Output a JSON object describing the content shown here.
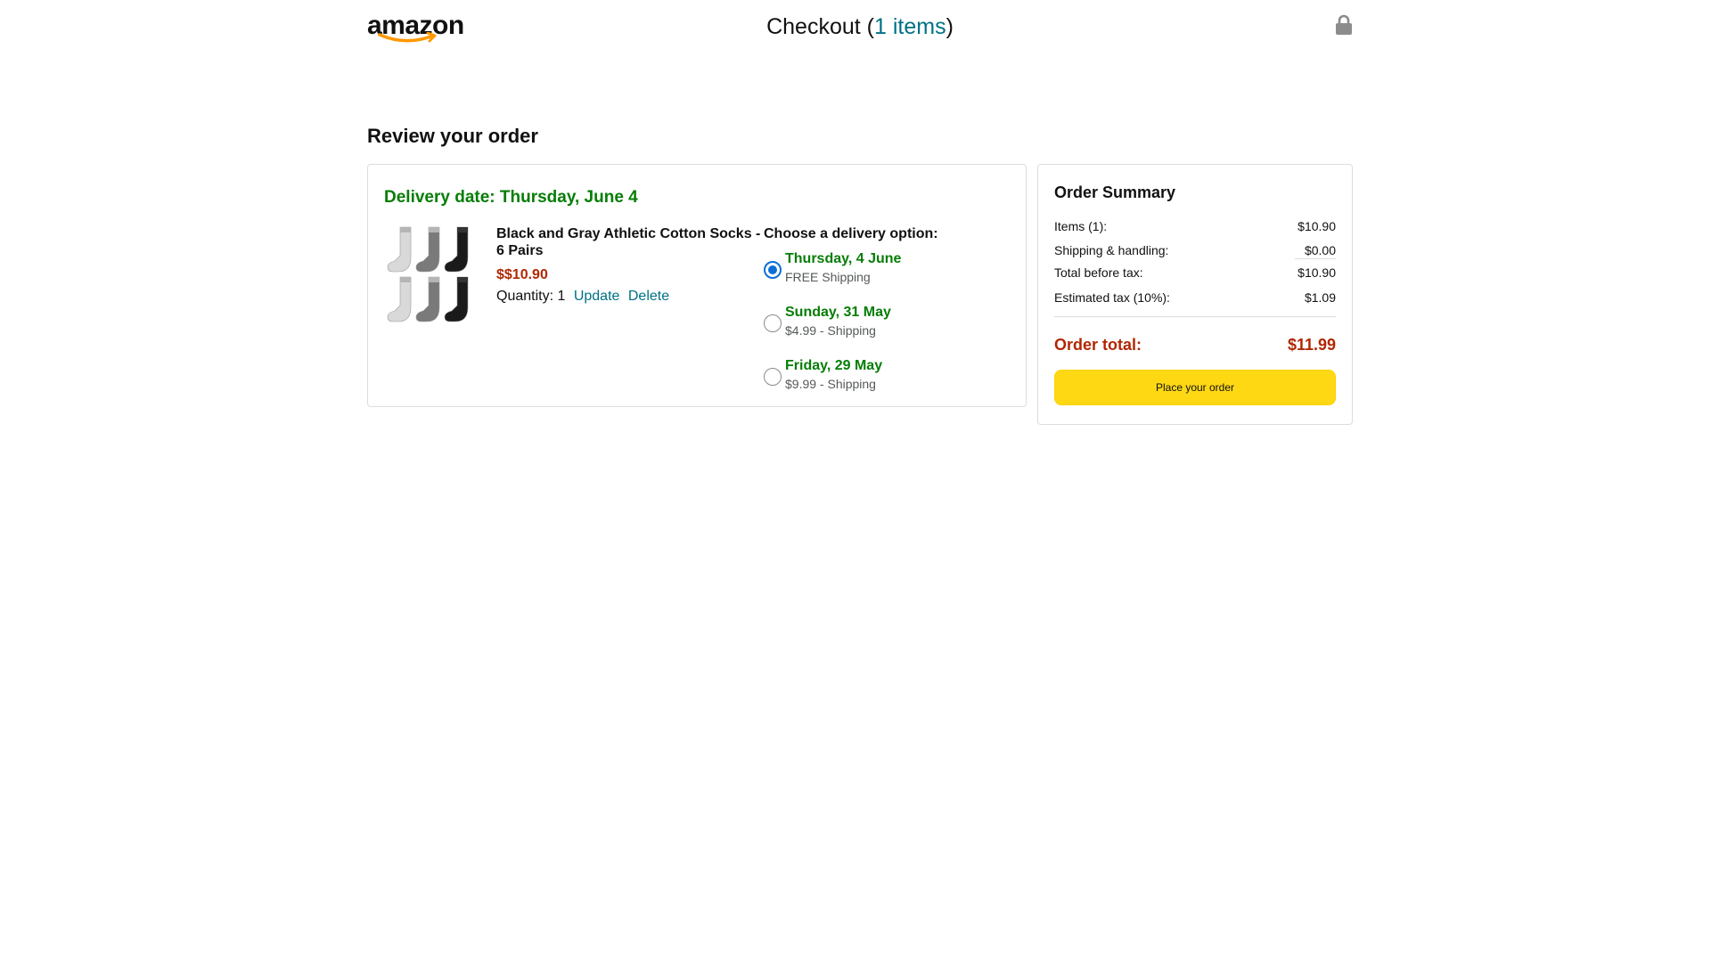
{
  "header": {
    "logo_text": "amazon",
    "checkout_prefix": "Checkout (",
    "checkout_count": "1 items",
    "checkout_suffix": ")",
    "lock_icon": "lock-icon"
  },
  "page_title": "Review your order",
  "order": {
    "delivery_date": "Delivery date: Thursday, June 4",
    "product": {
      "title": "Black and Gray Athletic Cotton Socks - 6 Pairs",
      "price": "$$10.90",
      "quantity_label": "Quantity: 1",
      "update_label": "Update",
      "delete_label": "Delete",
      "sock_colors": [
        "#d9d9d9",
        "#7a7a7a",
        "#1a1a1a",
        "#d9d9d9",
        "#7a7a7a",
        "#1a1a1a"
      ]
    },
    "delivery_options_title": "Choose a delivery option:",
    "delivery_options": [
      {
        "date": "Thursday, 4 June",
        "shipping": "FREE Shipping",
        "selected": true
      },
      {
        "date": "Sunday, 31 May",
        "shipping": "$4.99 - Shipping",
        "selected": false
      },
      {
        "date": "Friday, 29 May",
        "shipping": "$9.99 - Shipping",
        "selected": false
      }
    ]
  },
  "summary": {
    "title": "Order Summary",
    "items_label": "Items (1):",
    "items_value": "$10.90",
    "shipping_label": "Shipping & handling:",
    "shipping_value": "$0.00",
    "before_tax_label": "Total before tax:",
    "before_tax_value": "$10.90",
    "tax_label": "Estimated tax (10%):",
    "tax_value": "$1.09",
    "total_label": "Order total:",
    "total_value": "$11.99",
    "place_order_label": "Place your order"
  },
  "colors": {
    "accent_link": "#007185",
    "delivery_green": "#067d06",
    "price_red": "#b12704",
    "button_yellow": "#ffd814",
    "radio_blue": "#0b6fd6"
  }
}
